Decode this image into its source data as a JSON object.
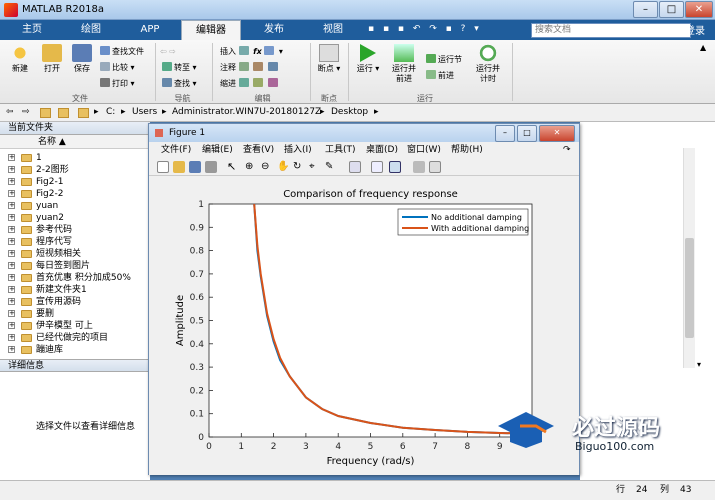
{
  "window": {
    "title": "MATLAB R2018a",
    "min": "–",
    "max": "□",
    "close": "✕"
  },
  "tabs": [
    "主页",
    "绘图",
    "APP",
    "编辑器",
    "发布",
    "视图"
  ],
  "search_placeholder": "搜索文档",
  "login": "登录",
  "ribbon": {
    "new": "新建",
    "open": "打开",
    "save": "保存",
    "find_files": "查找文件",
    "compare": "比较",
    "print": "打印",
    "goto": "转至",
    "find": "查找",
    "insert": "插入",
    "comment": "注释",
    "indent": "缩进",
    "breakpoints": "断点",
    "run": "运行",
    "run_advance": "运行并\n前进",
    "run_section": "运行节",
    "advance": "前进",
    "run_time": "运行并\n计时",
    "groups": {
      "file": "文件",
      "nav": "导航",
      "edit": "编辑",
      "bp": "断点",
      "run": "运行"
    }
  },
  "address": {
    "path": [
      "C:",
      "Users",
      "Administrator.WIN7U-20180127Z",
      "Desktop"
    ],
    "sep": "▸"
  },
  "left": {
    "header": "当前文件夹",
    "col": "名称 ▲",
    "items": [
      "1",
      "2-2图形",
      "Fig2-1",
      "Fig2-2",
      "yuan",
      "yuan2",
      "参考代码",
      "程序代写",
      "短视频相关",
      "每日签到图片",
      "首充优惠 积分加成50%",
      "新建文件夹1",
      "宣传用源码",
      "要删",
      "伊辛模型 可上",
      "已经代做完的项目",
      "蹦迪库"
    ],
    "detail_header": "详细信息",
    "detail_text": "选择文件以查看详细信息"
  },
  "status": {
    "row_label": "行",
    "row": "24",
    "col_label": "列",
    "col": "43"
  },
  "figure": {
    "title": "Figure 1",
    "menu": [
      "文件(F)",
      "编辑(E)",
      "查看(V)",
      "插入(I)",
      "工具(T)",
      "桌面(D)",
      "窗口(W)",
      "帮助(H)"
    ]
  },
  "chart_data": {
    "type": "line",
    "title": "Comparison of frequency response",
    "xlabel": "Frequency (rad/s)",
    "ylabel": "Amplitude",
    "xlim": [
      0,
      10
    ],
    "ylim": [
      0,
      1
    ],
    "xticks": [
      0,
      1,
      2,
      3,
      4,
      5,
      6,
      7,
      8,
      9
    ],
    "yticks": [
      0,
      0.1,
      0.2,
      0.3,
      0.4,
      0.5,
      0.6,
      0.7,
      0.8,
      0.9,
      1
    ],
    "legend_position": "top-right",
    "series": [
      {
        "name": "No additional damping",
        "color": "#0072bd",
        "x": [
          1.4,
          1.5,
          1.6,
          1.8,
          2,
          2.2,
          2.5,
          3,
          3.5,
          4,
          5,
          6,
          7,
          8,
          9,
          10
        ],
        "y": [
          1,
          0.8,
          0.69,
          0.52,
          0.41,
          0.33,
          0.26,
          0.17,
          0.12,
          0.09,
          0.06,
          0.04,
          0.03,
          0.022,
          0.017,
          0.014
        ]
      },
      {
        "name": "With additional damping",
        "color": "#d95319",
        "x": [
          1.4,
          1.5,
          1.6,
          1.8,
          2,
          2.2,
          2.5,
          3,
          3.5,
          4,
          5,
          6,
          7,
          8,
          9,
          10
        ],
        "y": [
          1,
          0.82,
          0.7,
          0.53,
          0.42,
          0.34,
          0.26,
          0.17,
          0.12,
          0.09,
          0.06,
          0.04,
          0.03,
          0.022,
          0.017,
          0.014
        ]
      }
    ]
  },
  "watermark": {
    "brand": "必过源码",
    "url": "Biguo100.com"
  },
  "colors": {
    "ribbon_tab_bg": "#1f5d9c",
    "series1": "#0072bd",
    "series2": "#d95319"
  }
}
